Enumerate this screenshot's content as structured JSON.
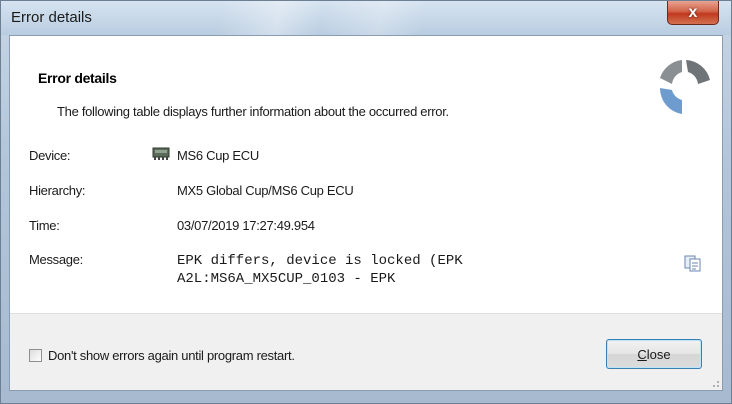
{
  "window": {
    "title": "Error details",
    "close_glyph": "x"
  },
  "header": {
    "title": "Error details",
    "subtitle": "The following table displays further information about the occurred error.",
    "logo_icon": "vendor-logo-icon"
  },
  "details": {
    "device": {
      "label": "Device:",
      "value": "MS6 Cup ECU",
      "icon": "ecu-chip-icon"
    },
    "hierarchy": {
      "label": "Hierarchy:",
      "value": "MX5 Global Cup/MS6 Cup ECU"
    },
    "time": {
      "label": "Time:",
      "value": "03/07/2019 17:27:49.954"
    },
    "message": {
      "label": "Message:",
      "line1": "EPK differs, device is locked (EPK",
      "line2": "A2L:MS6A_MX5CUP_0103 - EPK",
      "copy_icon": "copy-icon"
    }
  },
  "footer": {
    "checkbox_label": "Don't show errors again until program restart.",
    "checkbox_checked": false,
    "close_mnemonic": "C",
    "close_rest": "lose"
  },
  "colors": {
    "accent_border": "#3c7fb1",
    "close_red": "#c0391f",
    "logo_gray": "#6f7478",
    "logo_blue": "#6f9ccf"
  }
}
